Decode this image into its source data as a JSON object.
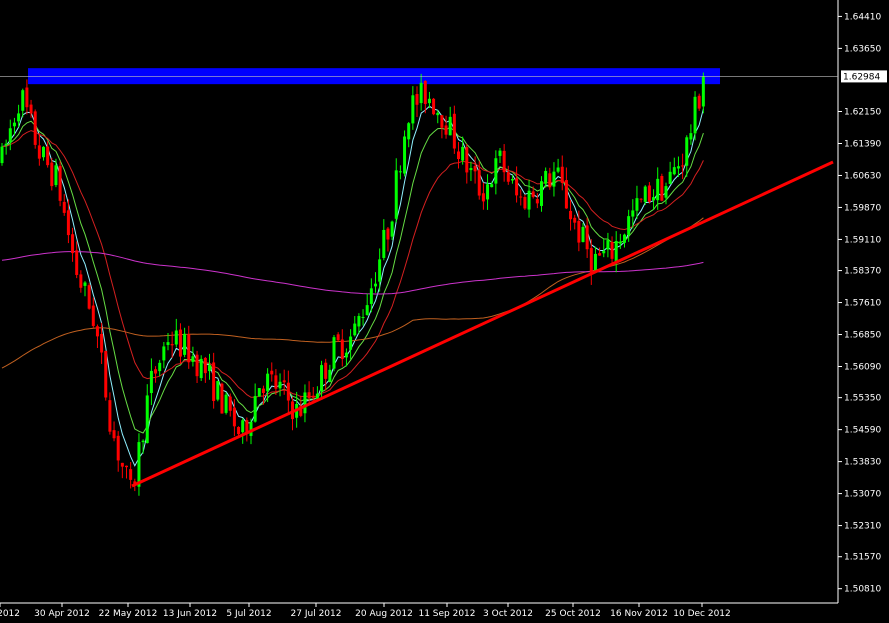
{
  "chart_data": {
    "type": "candlestick",
    "instrument_note": "",
    "y_ticks": [
      "1.64410",
      "1.63650",
      "1.62984",
      "1.62150",
      "1.61390",
      "1.60630",
      "1.59870",
      "1.59110",
      "1.58370",
      "1.57610",
      "1.56850",
      "1.56090",
      "1.55350",
      "1.54590",
      "1.53830",
      "1.53070",
      "1.52310",
      "1.51570",
      "1.50810"
    ],
    "current_price": "1.62984",
    "x_ticks": [
      "2012",
      "30 Apr 2012",
      "22 May 2012",
      "13 Jun 2012",
      "5 Jul 2012",
      "27 Jul 2012",
      "20 Aug 2012",
      "11 Sep 2012",
      "3 Oct 2012",
      "25 Oct 2012",
      "16 Nov 2012",
      "10 Dec 2012"
    ],
    "ylim": [
      1.5047,
      1.648
    ],
    "grid": false,
    "colors": {
      "background": "#000000",
      "bull": "#00ff00",
      "bear": "#ff0000",
      "resistance_zone": "#0000ff",
      "trendline": "#ff0000",
      "ma_fast": "#8ff0ff",
      "ma_mid": "#66dd44",
      "ma_slow": "#d42020",
      "ma_long": "#c06020",
      "ma_longest": "#cc33cc",
      "axis": "#ffffff",
      "price_line": "#c0c0c0"
    },
    "resistance_zone": {
      "low": 1.628,
      "high": 1.6318
    },
    "trendline": {
      "from": {
        "date": "22 May 2012",
        "price": 1.5325
      },
      "to": {
        "date": "10 Dec 2012",
        "price": 1.608
      }
    },
    "price_path": [
      [
        1.588,
        1.61
      ],
      [
        1.628,
        1.626
      ],
      [
        1.619,
        1.612
      ],
      [
        1.609,
        1.605
      ],
      [
        1.598,
        1.584
      ],
      [
        1.58,
        1.572
      ],
      [
        1.56,
        1.545
      ],
      [
        1.54,
        1.53
      ],
      [
        1.545,
        1.556
      ],
      [
        1.558,
        1.568
      ],
      [
        1.562,
        1.565
      ],
      [
        1.566,
        1.56
      ],
      [
        1.556,
        1.552
      ],
      [
        1.547,
        1.544
      ],
      [
        1.548,
        1.558
      ],
      [
        1.562,
        1.556
      ],
      [
        1.552,
        1.55
      ],
      [
        1.546,
        1.556
      ],
      [
        1.561,
        1.565
      ],
      [
        1.568,
        1.568
      ],
      [
        1.57,
        1.58
      ],
      [
        1.59,
        1.595
      ],
      [
        1.61,
        1.622
      ],
      [
        1.628,
        1.626
      ],
      [
        1.624,
        1.62
      ],
      [
        1.614,
        1.61
      ],
      [
        1.603,
        1.602
      ],
      [
        1.607,
        1.61
      ],
      [
        1.605,
        1.6
      ],
      [
        1.6,
        1.603
      ],
      [
        1.606,
        1.607
      ],
      [
        1.6,
        1.595
      ],
      [
        1.59,
        1.586
      ],
      [
        1.585,
        1.588
      ],
      [
        1.59,
        1.596
      ],
      [
        1.598,
        1.602
      ],
      [
        1.605,
        1.604
      ],
      [
        1.608,
        1.612
      ],
      [
        1.616,
        1.629
      ]
    ]
  }
}
